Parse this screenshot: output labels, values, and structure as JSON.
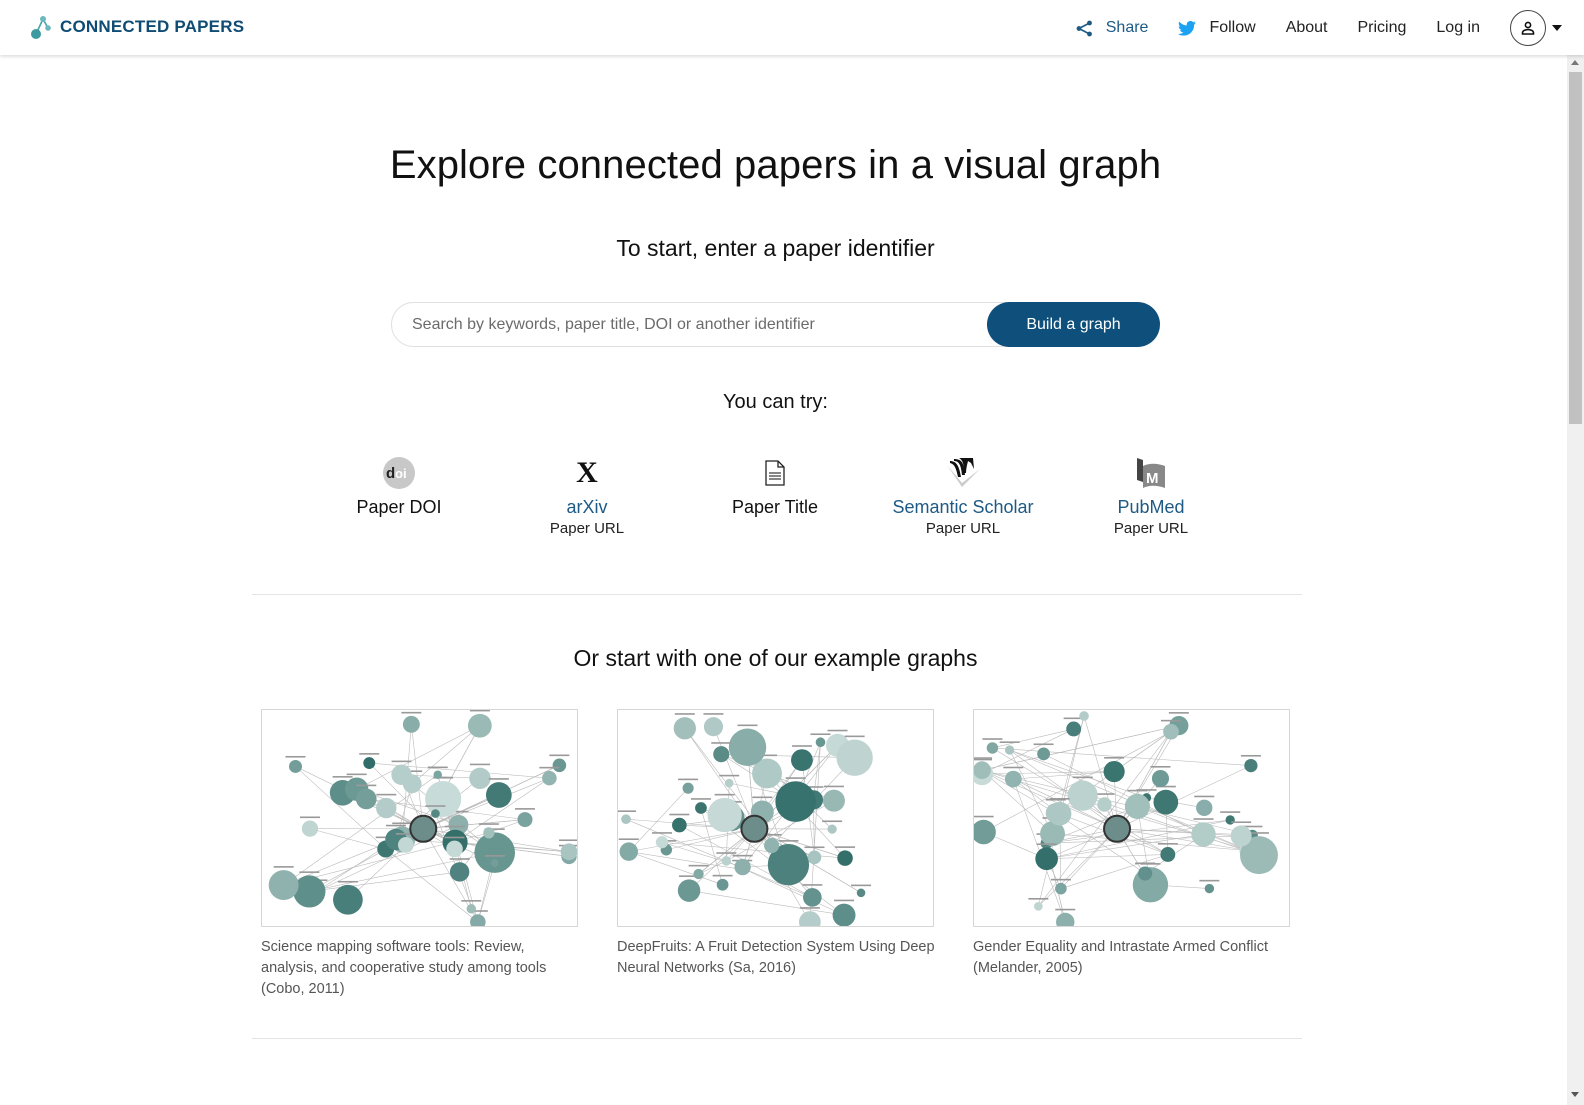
{
  "header": {
    "logo_text": "CONNECTED PAPERS",
    "nav": {
      "share": "Share",
      "follow": "Follow",
      "about": "About",
      "pricing": "Pricing",
      "login": "Log in"
    },
    "icons": {
      "share": "share-icon",
      "follow": "twitter-icon",
      "account": "user-icon"
    }
  },
  "hero": {
    "title": "Explore connected papers in a visual graph",
    "subtitle": "To start, enter a paper identifier"
  },
  "search": {
    "placeholder": "Search by keywords, paper title, DOI or another identifier",
    "value": "",
    "button_label": "Build a graph"
  },
  "try": {
    "label": "You can try:",
    "items": [
      {
        "icon": "doi-icon",
        "main": "Paper DOI",
        "sub": "",
        "link": false
      },
      {
        "icon": "arxiv-icon",
        "main": "arXiv",
        "sub": "Paper URL",
        "link": true
      },
      {
        "icon": "document-icon",
        "main": "Paper Title",
        "sub": "",
        "link": false
      },
      {
        "icon": "semantic-scholar-icon",
        "main": "Semantic Scholar",
        "sub": "Paper URL",
        "link": true
      },
      {
        "icon": "pubmed-icon",
        "main": "PubMed",
        "sub": "Paper URL",
        "link": true
      }
    ]
  },
  "examples": {
    "title": "Or start with one of our example graphs",
    "cards": [
      {
        "caption": "Science mapping software tools: Review, analysis, and cooperative study among tools (Cobo, 2011)"
      },
      {
        "caption": "DeepFruits: A Fruit Detection System Using Deep Neural Networks (Sa, 2016)"
      },
      {
        "caption": "Gender Equality and Intrastate Armed Conflict (Melander, 2005)"
      }
    ]
  },
  "colors": {
    "brand": "#0f4c74",
    "button": "#0e4f7b",
    "link": "#1d5a85",
    "node_dark": "#2e6b66",
    "node_light": "#c9dcd9"
  }
}
